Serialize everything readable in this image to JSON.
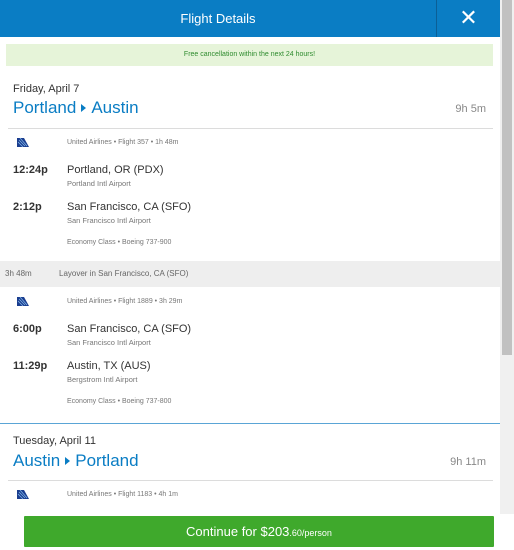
{
  "header": {
    "title": "Flight Details",
    "close_glyph": "✕"
  },
  "notice": "Free cancellation within the next 24 hours!",
  "outbound": {
    "date": "Friday, April 7",
    "from": "Portland",
    "to": "Austin",
    "duration": "9h 5m",
    "segments": [
      {
        "flight": "United Airlines • Flight 357 • 1h 48m",
        "depart_time": "12:24p",
        "depart_city": "Portland, OR (PDX)",
        "depart_airport": "Portland Intl Airport",
        "arrive_time": "2:12p",
        "arrive_city": "San Francisco, CA (SFO)",
        "arrive_airport": "San Francisco Intl Airport",
        "cabin": "Economy Class • Boeing 737-900"
      },
      {
        "flight": "United Airlines • Flight 1889 • 3h 29m",
        "depart_time": "6:00p",
        "depart_city": "San Francisco, CA (SFO)",
        "depart_airport": "San Francisco Intl Airport",
        "arrive_time": "11:29p",
        "arrive_city": "Austin, TX (AUS)",
        "arrive_airport": "Bergstrom Intl Airport",
        "cabin": "Economy Class • Boeing 737-800"
      }
    ],
    "layover": {
      "duration": "3h 48m",
      "text": "Layover in San Francisco, CA (SFO)"
    }
  },
  "return": {
    "date": "Tuesday, April 11",
    "from": "Austin",
    "to": "Portland",
    "duration": "9h 11m",
    "segments": [
      {
        "flight": "United Airlines • Flight 1183 • 4h 1m"
      }
    ]
  },
  "footer": {
    "continue_main": "Continue for $203",
    "continue_cents": ".60/person"
  },
  "colors": {
    "brand_blue": "#0a7dc4",
    "action_green": "#3fa92c",
    "notice_bg": "#e6f4d9"
  },
  "icons": {
    "airline": "united-airlines-logo-icon",
    "close": "close-icon"
  }
}
